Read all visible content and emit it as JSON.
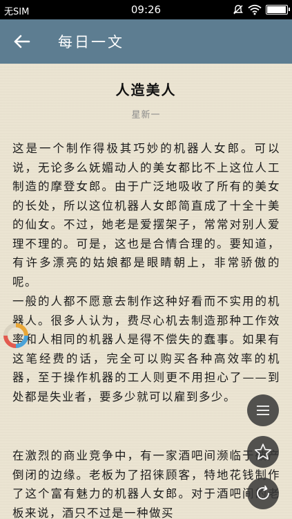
{
  "status_bar": {
    "carrier": "无SIM",
    "time": "09:26",
    "icons": [
      "mute-icon",
      "wifi-icon",
      "battery-icon"
    ],
    "battery_level": 0.95
  },
  "app_bar": {
    "title": "每日一文",
    "back_icon": "arrow-left-icon",
    "background_color": "#5d7d91"
  },
  "article": {
    "title": "人造美人",
    "author": "星新一",
    "paragraphs": [
      "这是一个制作得极其巧妙的机器人女郎。可以说，无论多么妩媚动人的美女都比不上这位人工制造的摩登女郎。由于广泛地吸收了所有的美女的长处，所以这位机器人女郎简直成了十全十美的仙女。不过，她老是爱摆架子，常常对别人爱理不理的。可是，这也是合情合理的。要知道，有许多漂亮的姑娘都是眼睛朝上，非常骄傲的呢。",
      "一般的人都不愿意去制作这种好看而不实用的机器人。很多人认为，费尽心机去制造那种工作效率和人相同的机器人是得不偿失的蠢事。如果有这笔经费的话，完全可以购买各种高效率的机器，至于操作机器的工人则更不用担心了——到处都是失业者，要多少就可以雇到多少。",
      "在激烈的商业竞争中，有一家酒吧间濒临于破产倒闭的边缘。老板为了招徕顾客，特地花钱制作了这个富有魅力的机器人女郎。对于酒吧间的老板来说，酒只不过是一种做买"
    ]
  },
  "floating_buttons": [
    {
      "icon": "menu-icon"
    },
    {
      "icon": "star-icon"
    },
    {
      "icon": "refresh-icon"
    }
  ]
}
